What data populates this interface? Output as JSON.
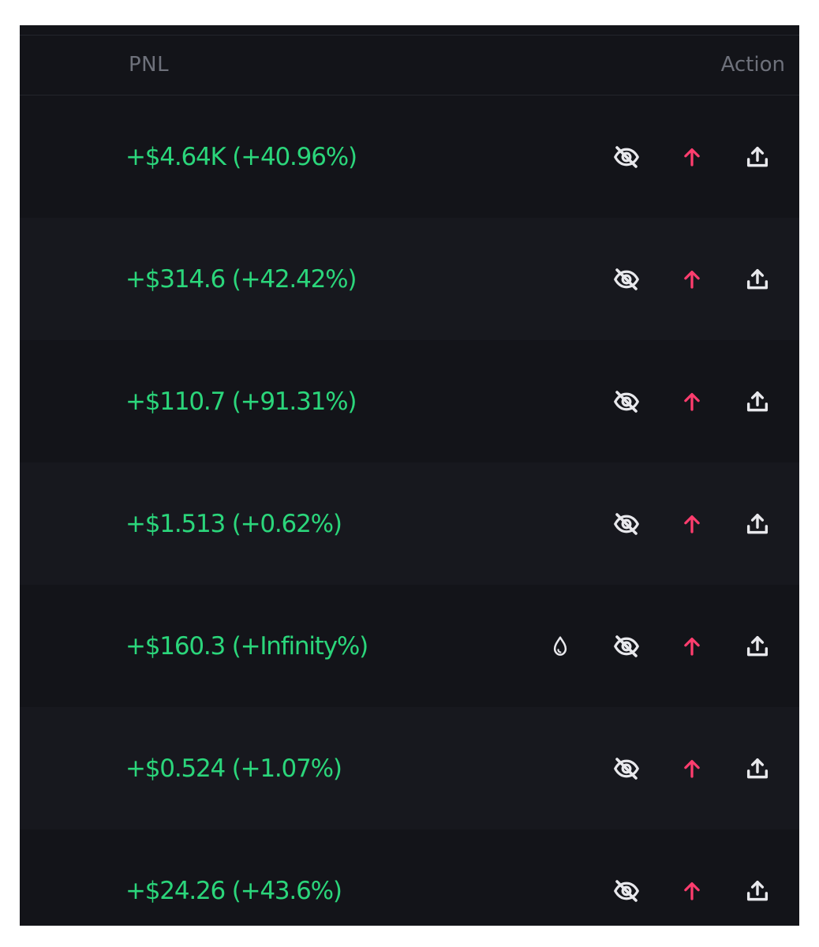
{
  "table": {
    "columns": {
      "pnl": "PNL",
      "action": "Action"
    },
    "colors": {
      "positive": "#2bd67b",
      "arrow": "#ff3d6e",
      "icon": "#e8e8ec"
    },
    "rows": [
      {
        "pnl": "+$4.64K (+40.96%)",
        "icons": [
          "hide-icon",
          "arrow-up-icon",
          "share-icon"
        ]
      },
      {
        "pnl": "+$314.6 (+42.42%)",
        "icons": [
          "hide-icon",
          "arrow-up-icon",
          "share-icon"
        ]
      },
      {
        "pnl": "+$110.7 (+91.31%)",
        "icons": [
          "hide-icon",
          "arrow-up-icon",
          "share-icon"
        ]
      },
      {
        "pnl": "+$1.513 (+0.62%)",
        "icons": [
          "hide-icon",
          "arrow-up-icon",
          "share-icon"
        ]
      },
      {
        "pnl": "+$160.3 (+Infinity%)",
        "icons": [
          "drop-icon",
          "hide-icon",
          "arrow-up-icon",
          "share-icon"
        ]
      },
      {
        "pnl": "+$0.524 (+1.07%)",
        "icons": [
          "hide-icon",
          "arrow-up-icon",
          "share-icon"
        ]
      },
      {
        "pnl": "+$24.26 (+43.6%)",
        "icons": [
          "hide-icon",
          "arrow-up-icon",
          "share-icon"
        ]
      }
    ]
  }
}
